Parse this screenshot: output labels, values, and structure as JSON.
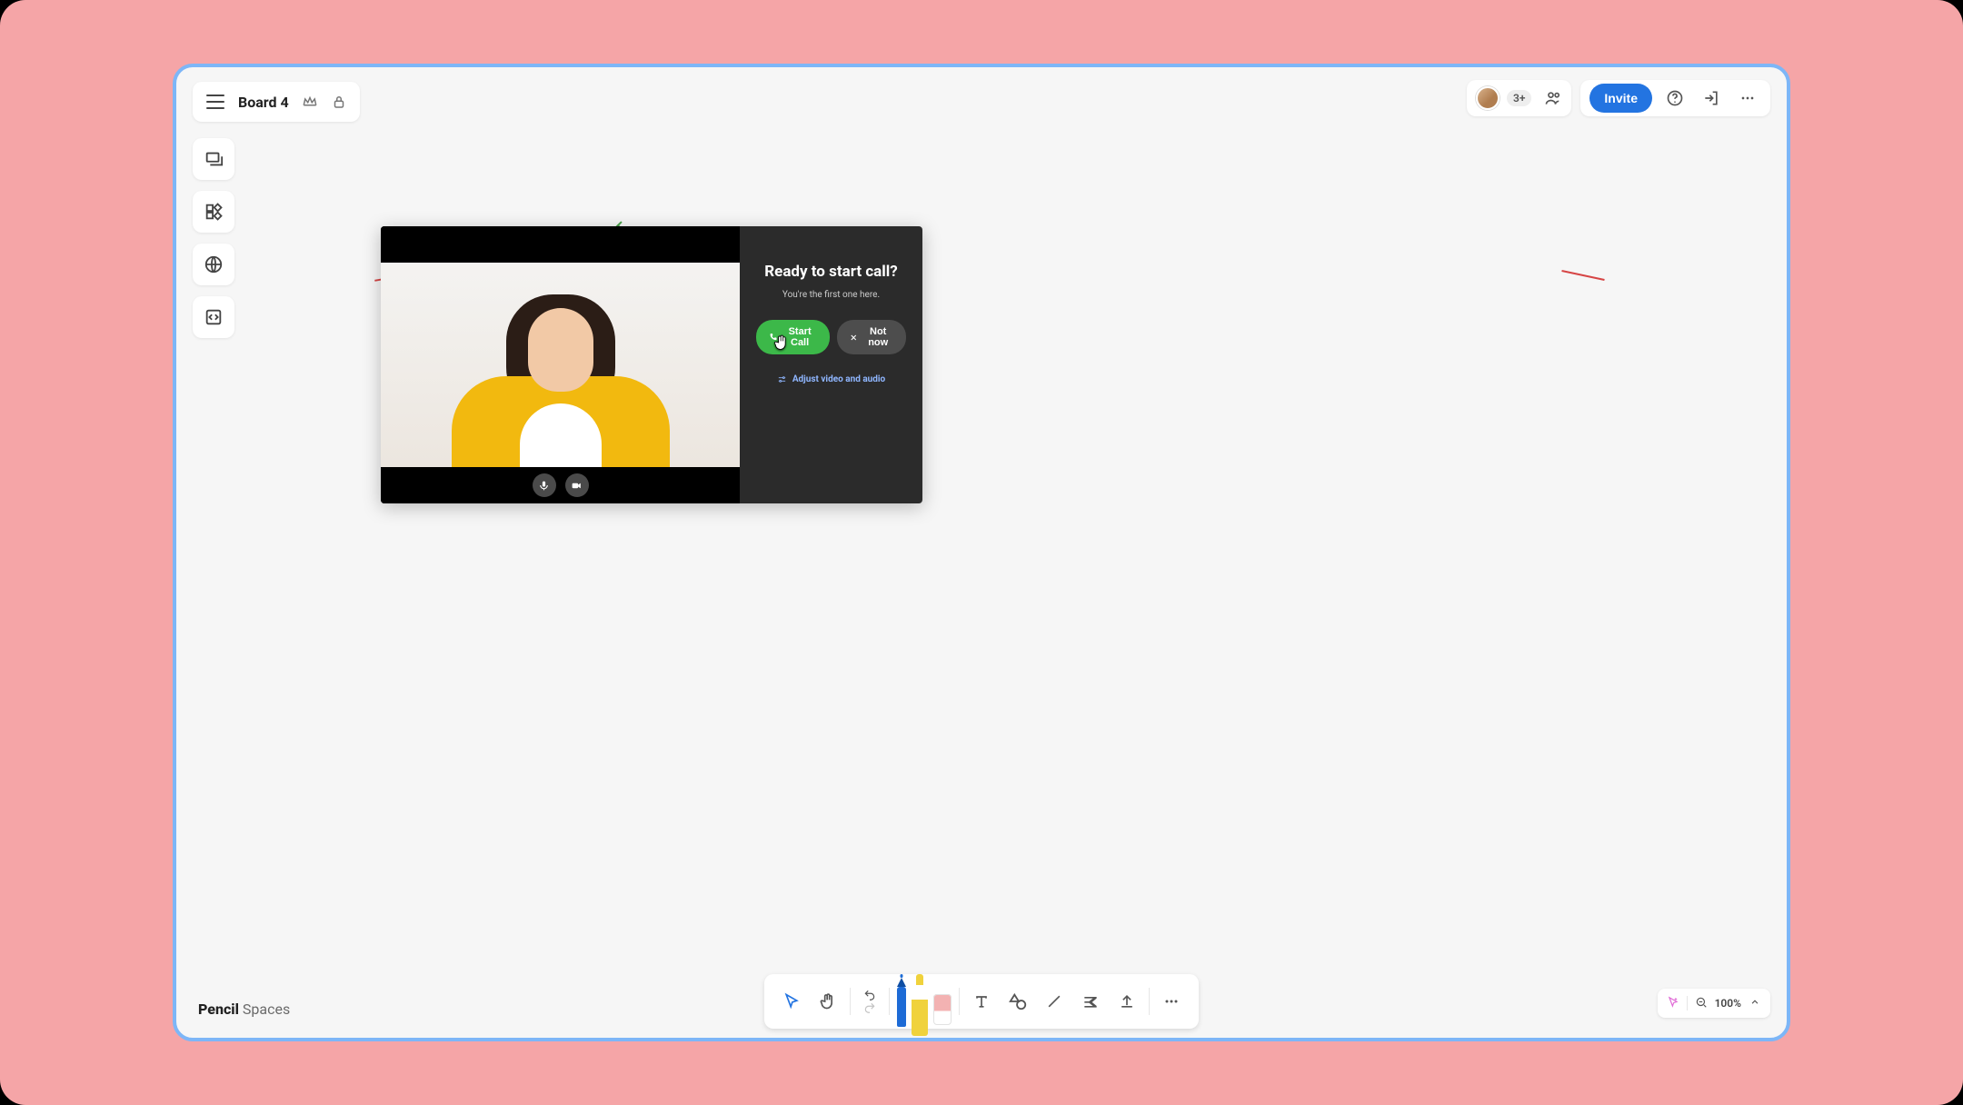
{
  "header": {
    "board_title": "Board 4",
    "participants_count": "3+",
    "invite_label": "Invite"
  },
  "call_dialog": {
    "title": "Ready to start call?",
    "subtitle": "You're the first one here.",
    "start_label": "Start Call",
    "dismiss_label": "Not now",
    "adjust_label": "Adjust video and audio"
  },
  "brand": {
    "bold": "Pencil",
    "light": " Spaces"
  },
  "zoom": {
    "level": "100%"
  }
}
